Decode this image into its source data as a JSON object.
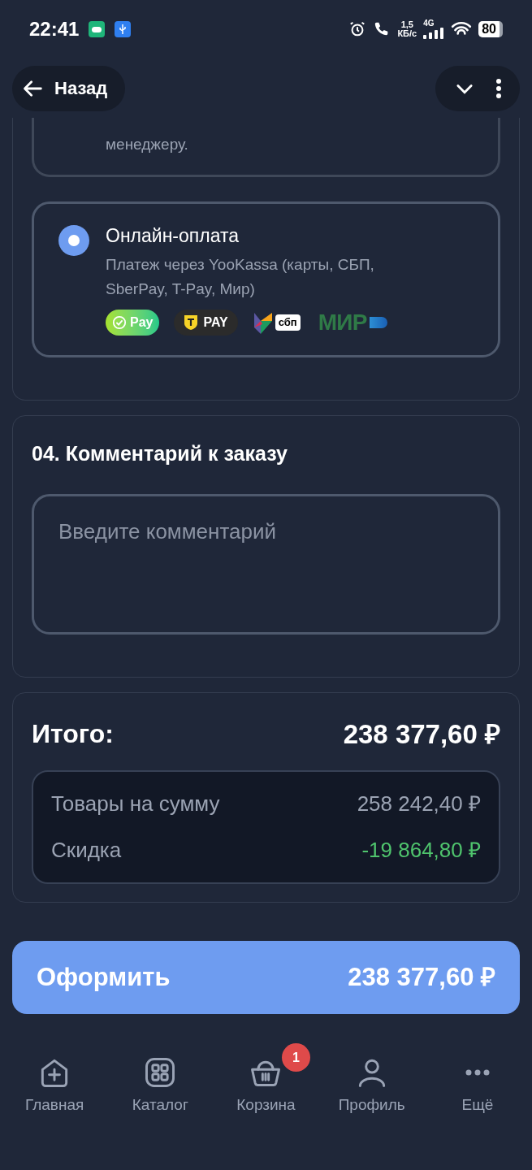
{
  "status_bar": {
    "time": "22:41",
    "speed_value": "1,5",
    "speed_unit": "КБ/с",
    "network": "4G",
    "battery": "80"
  },
  "header": {
    "back_label": "Назад"
  },
  "payment_options": [
    {
      "description": "менеджеру.",
      "selected": false
    },
    {
      "title": "Онлайн-оплата",
      "description": "Платеж через YooKassa (карты, СБП, SberPay, T-Pay, Мир)",
      "selected": true,
      "logos": [
        {
          "kind": "sberpay",
          "label": "Pay"
        },
        {
          "kind": "tpay",
          "label": "PAY"
        },
        {
          "kind": "sbp",
          "label": "сбп"
        },
        {
          "kind": "mir",
          "label": "МИР"
        }
      ]
    }
  ],
  "comment": {
    "title": "04. Комментарий к заказу",
    "placeholder": "Введите комментарий"
  },
  "total": {
    "label": "Итого:",
    "value": "238 377,60 ₽",
    "lines": [
      {
        "label": "Товары на сумму",
        "value": "258 242,40 ₽",
        "kind": "normal"
      },
      {
        "label": "Скидка",
        "value": "-19 864,80 ₽",
        "kind": "discount"
      }
    ]
  },
  "submit": {
    "label": "Оформить",
    "value": "238 377,60 ₽"
  },
  "nav": [
    {
      "label": "Главная",
      "kind": "home"
    },
    {
      "label": "Каталог",
      "kind": "catalog"
    },
    {
      "label": "Корзина",
      "kind": "cart",
      "badge": "1"
    },
    {
      "label": "Профиль",
      "kind": "profile"
    },
    {
      "label": "Ещё",
      "kind": "more"
    }
  ]
}
